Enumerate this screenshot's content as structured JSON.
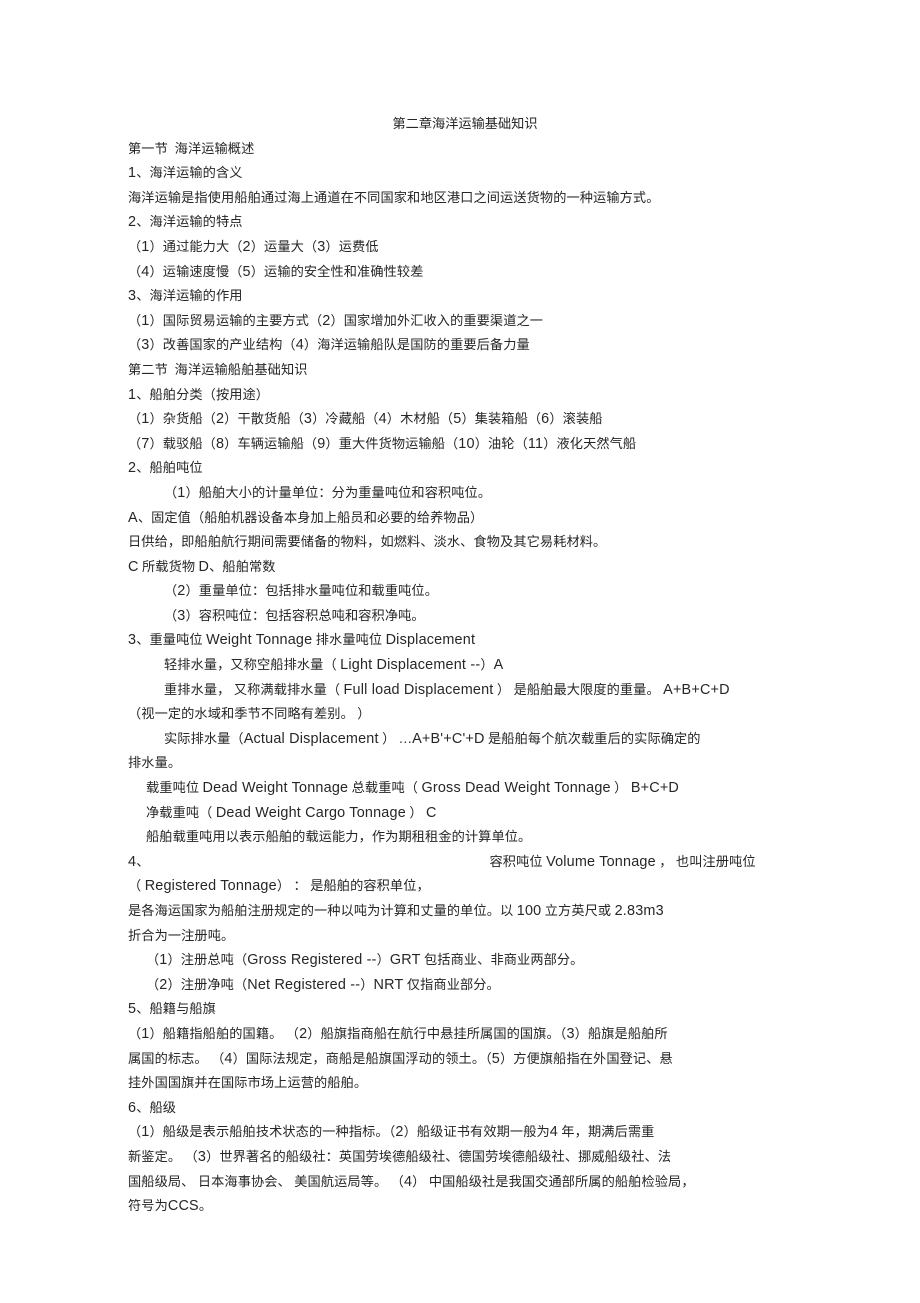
{
  "document": {
    "title": "第二章海洋运输基础知识",
    "lines": [
      {
        "id": "l01",
        "text": "第一节  海洋运输概述",
        "indent": 0
      },
      {
        "id": "l02",
        "text": "1、海洋运输的含义",
        "indent": 0
      },
      {
        "id": "l03",
        "text": "海洋运输是指使用船舶通过海上通道在不同国家和地区港口之间运送货物的一种运输方式。",
        "indent": 0
      },
      {
        "id": "l04",
        "text": "2、海洋运输的特点",
        "indent": 0
      },
      {
        "id": "l05",
        "text": "（1）通过能力大（2）运量大（3）运费低",
        "indent": 0
      },
      {
        "id": "l06",
        "text": "（4）运输速度慢（5）运输的安全性和准确性较差",
        "indent": 0
      },
      {
        "id": "l07",
        "text": "3、海洋运输的作用",
        "indent": 0
      },
      {
        "id": "l08",
        "text": "（1）国际贸易运输的主要方式（2）国家增加外汇收入的重要渠道之一",
        "indent": 0
      },
      {
        "id": "l09",
        "text": "（3）改善国家的产业结构（4）海洋运输船队是国防的重要后备力量",
        "indent": 0
      },
      {
        "id": "l10",
        "text": "第二节  海洋运输船舶基础知识",
        "indent": 0
      },
      {
        "id": "l11",
        "text": "1、船舶分类（按用途）",
        "indent": 0
      },
      {
        "id": "l12",
        "text": "（1）杂货船（2）干散货船（3）冷藏船（4）木材船（5）集装箱船（6）滚装船",
        "indent": 0
      },
      {
        "id": "l13",
        "text": "（7）载驳船（8）车辆运输船（9）重大件货物运输船（10）油轮（11）液化天然气船",
        "indent": 0
      },
      {
        "id": "l14",
        "text": "2、船舶吨位",
        "indent": 0
      },
      {
        "id": "l15",
        "text": "（1）船舶大小的计量单位：分为重量吨位和容积吨位。",
        "indent": 2
      },
      {
        "id": "l16",
        "text": "A、固定值（船舶机器设备本身加上船员和必要的给养物品）",
        "indent": 0
      },
      {
        "id": "l17",
        "text": "日供给，即船舶航行期间需要储备的物料，如燃料、淡水、食物及其它易耗材料。",
        "indent": 0
      },
      {
        "id": "l18",
        "text": "C 所载货物 D、船舶常数",
        "indent": 0
      },
      {
        "id": "l19",
        "text": "（2）重量单位：包括排水量吨位和载重吨位。",
        "indent": 2
      },
      {
        "id": "l20",
        "text": "（3）容积吨位：包括容积总吨和容积净吨。",
        "indent": 2
      },
      {
        "id": "l21",
        "text": "3、重量吨位 Weight Tonnage 排水量吨位 Displacement",
        "indent": 0
      },
      {
        "id": "l22",
        "text": "轻排水量，又称空船排水量（ Light Displacement --）A",
        "indent": 2
      },
      {
        "id": "l23",
        "text": "重排水量， 又称满载排水量（ Full load Displacement ） 是船舶最大限度的重量。 A+B+C+D",
        "indent": 2
      },
      {
        "id": "l24",
        "text": "（视一定的水域和季节不同略有差别。 ）",
        "indent": 0
      },
      {
        "id": "l25",
        "text": "实际排水量（Actual Displacement ） …A+B'+C'+D 是船舶每个航次载重后的实际确定的",
        "indent": 2
      },
      {
        "id": "l26",
        "text": "排水量。",
        "indent": 0
      },
      {
        "id": "l27",
        "text": "载重吨位 Dead Weight Tonnage 总载重吨（ Gross Dead Weight Tonnage ） B+C+D",
        "indent": 1
      },
      {
        "id": "l28",
        "text": "净载重吨（ Dead Weight Cargo Tonnage ） C",
        "indent": 1
      },
      {
        "id": "l29",
        "text": "船舶载重吨用以表示船舶的载运能力，作为期租租金的计算单位。",
        "indent": 1
      },
      {
        "id": "l30a",
        "text": "4、",
        "indent": 0
      },
      {
        "id": "l30b",
        "text": "容积吨位 Volume Tonnage ， 也叫注册吨位",
        "indent": 0
      },
      {
        "id": "l31",
        "text": "（ Registered Tonnage） ： 是船舶的容积单位，",
        "indent": 0
      },
      {
        "id": "l32",
        "text": "是各海运国家为船舶注册规定的一种以吨为计算和丈量的单位。以 100 立方英尺或 2.83m3",
        "indent": 0
      },
      {
        "id": "l33",
        "text": "折合为一注册吨。",
        "indent": 0
      },
      {
        "id": "l34",
        "text": "（1）注册总吨（Gross Registered --）GRT 包括商业、非商业两部分。",
        "indent": 1
      },
      {
        "id": "l35",
        "text": "（2）注册净吨（Net Registered --）NRT 仅指商业部分。",
        "indent": 1
      },
      {
        "id": "l36",
        "text": "5、船籍与船旗",
        "indent": 0
      },
      {
        "id": "l37",
        "text": "（1）船籍指船舶的国籍。 （2）船旗指商船在航行中悬挂所属国的国旗。（3）船旗是船舶所",
        "indent": 0
      },
      {
        "id": "l38",
        "text": "属国的标志。 （4）国际法规定，商船是船旗国浮动的领土。（5）方便旗船指在外国登记、悬",
        "indent": 0
      },
      {
        "id": "l39",
        "text": "挂外国国旗并在国际市场上运营的船舶。",
        "indent": 0
      },
      {
        "id": "l40",
        "text": "6、船级",
        "indent": 0
      },
      {
        "id": "l41",
        "text": "（1）船级是表示船舶技术状态的一种指标。（2）船级证书有效期一般为4 年，期满后需重",
        "indent": 0
      },
      {
        "id": "l42",
        "text": "新鉴定。 （3）世界著名的船级社：英国劳埃德船级社、德国劳埃德船级社、挪威船级社、法",
        "indent": 0
      },
      {
        "id": "l43",
        "text": "国船级局、 日本海事协会、 美国航运局等。 （4） 中国船级社是我国交通部所属的船舶检验局，",
        "indent": 0
      },
      {
        "id": "l44",
        "text": "符号为CCS。",
        "indent": 0
      }
    ]
  },
  "style": {
    "background_color": "#ffffff",
    "text_color": "#262626"
  }
}
